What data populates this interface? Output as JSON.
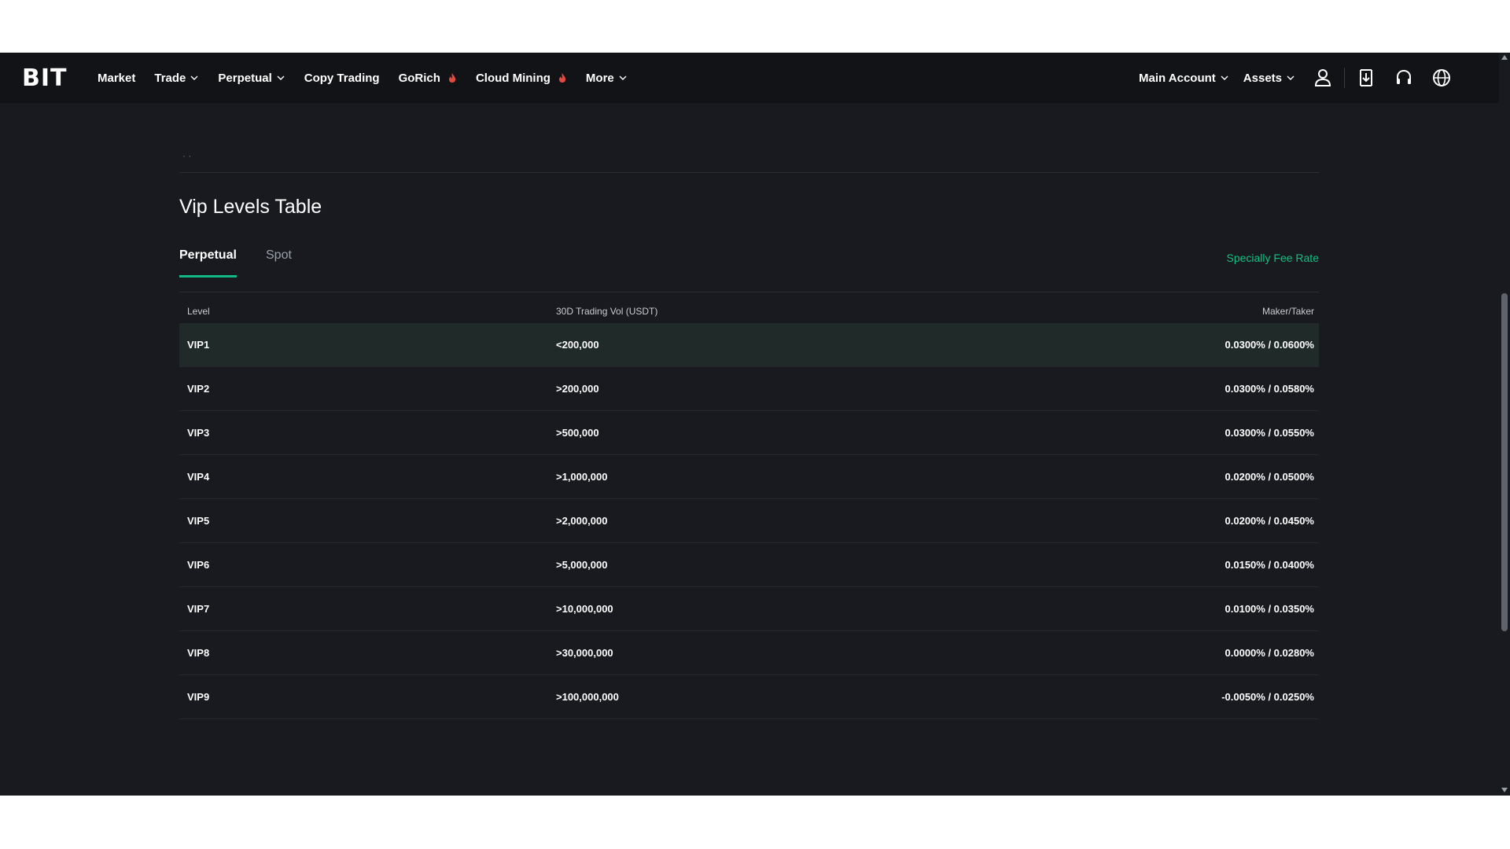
{
  "brand": {
    "logo_text": "BIT"
  },
  "nav": {
    "left_items": [
      {
        "label": "Market",
        "dropdown": false,
        "hot": false
      },
      {
        "label": "Trade",
        "dropdown": true,
        "hot": false
      },
      {
        "label": "Perpetual",
        "dropdown": true,
        "hot": false
      },
      {
        "label": "Copy Trading",
        "dropdown": false,
        "hot": false
      },
      {
        "label": "GoRich",
        "dropdown": false,
        "hot": true
      },
      {
        "label": "Cloud Mining",
        "dropdown": false,
        "hot": true
      },
      {
        "label": "More",
        "dropdown": true,
        "hot": false
      }
    ],
    "account_label": "Main Account",
    "assets_label": "Assets",
    "icons": [
      "user-icon",
      "download-icon",
      "headset-icon",
      "globe-icon"
    ]
  },
  "page": {
    "dots": "· ·",
    "section_title": "Vip Levels Table",
    "tabs": [
      {
        "label": "Perpetual",
        "active": true
      },
      {
        "label": "Spot",
        "active": false
      }
    ],
    "special_link": "Specially Fee Rate"
  },
  "table": {
    "headers": [
      "Level",
      "30D Trading Vol (USDT)",
      "Maker/Taker"
    ],
    "rows": [
      [
        "VIP1",
        "<200,000",
        "0.0300% / 0.0600%"
      ],
      [
        "VIP2",
        ">200,000",
        "0.0300% / 0.0580%"
      ],
      [
        "VIP3",
        ">500,000",
        "0.0300% / 0.0550%"
      ],
      [
        "VIP4",
        ">1,000,000",
        "0.0200% / 0.0500%"
      ],
      [
        "VIP5",
        ">2,000,000",
        "0.0200% / 0.0450%"
      ],
      [
        "VIP6",
        ">5,000,000",
        "0.0150% / 0.0400%"
      ],
      [
        "VIP7",
        ">10,000,000",
        "0.0100% / 0.0350%"
      ],
      [
        "VIP8",
        ">30,000,000",
        "0.0000% / 0.0280%"
      ],
      [
        "VIP9",
        ">100,000,000",
        "-0.0050% / 0.0250%"
      ]
    ],
    "highlighted_row": 0
  },
  "colors": {
    "background": "#181a1f",
    "navbar": "#121316",
    "accent": "#12c281",
    "highlight_row": "#1f2a29"
  }
}
